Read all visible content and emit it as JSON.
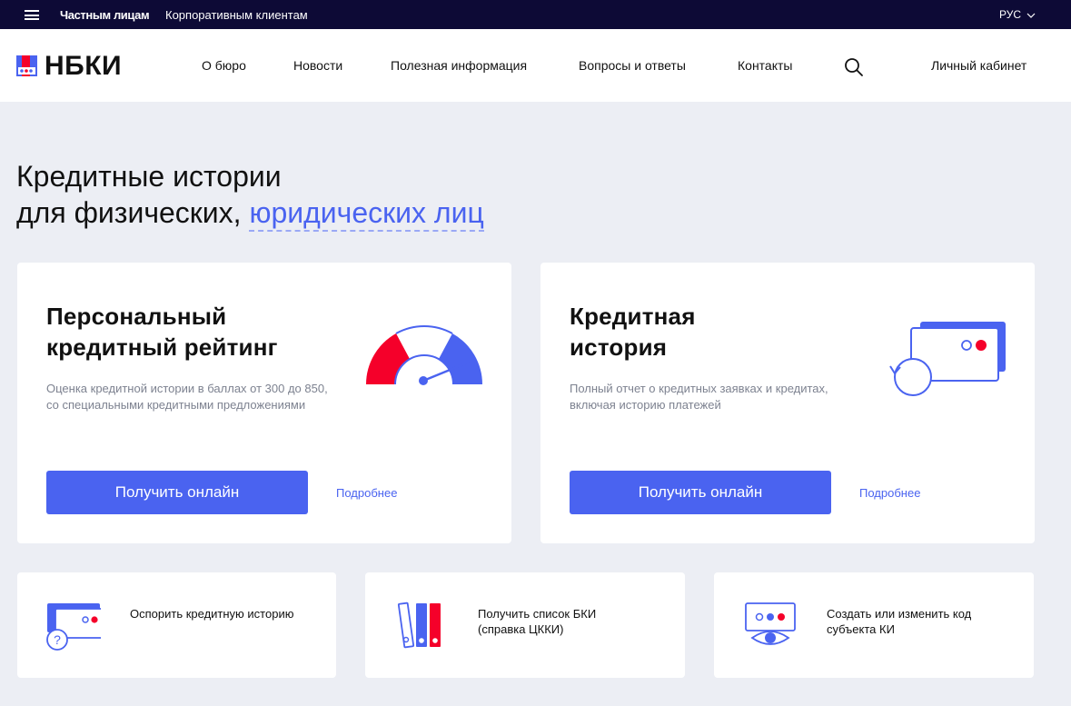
{
  "topbar": {
    "menu_icon": "burger-menu-icon",
    "link_private": "Частным лицам",
    "link_corporate": "Корпоративным клиентам",
    "language": "РУС"
  },
  "header": {
    "logo_text": "НБКИ",
    "nav": [
      "О бюро",
      "Новости",
      "Полезная информация",
      "Вопросы и ответы",
      "Контакты"
    ],
    "search_icon": "search-icon",
    "cabinet": "Личный кабинет"
  },
  "hero": {
    "title_line1": "Кредитные истории",
    "title_line2_prefix": "для физических,",
    "title_line2_accent": "юридических лиц"
  },
  "cards": [
    {
      "title": "Персональный\nкредитный рейтинг",
      "description": "Оценка кредитной истории в баллах от 300 до 850, со специальными кредитными предложениями",
      "button": "Получить онлайн",
      "more": "Подробнее",
      "icon": "speedometer-icon"
    },
    {
      "title": "Кредитная\nистория",
      "description": "Полный отчет о кредитных заявках и кредитах, включая историю платежей",
      "button": "Получить онлайн",
      "more": "Подробнее",
      "icon": "credit-card-history-icon"
    }
  ],
  "small_cards": [
    {
      "text": "Оспорить кредитную историю",
      "icon": "card-question-icon"
    },
    {
      "text": "Получить список БКИ (справка ЦККИ)",
      "icon": "binders-icon"
    },
    {
      "text": "Создать или изменить код субъекта КИ",
      "icon": "eye-monitor-icon"
    }
  ],
  "colors": {
    "brand_blue": "#4a63f0",
    "brand_red": "#f5002a",
    "topbar_bg": "#0d0a36",
    "page_bg": "#eceef4"
  }
}
